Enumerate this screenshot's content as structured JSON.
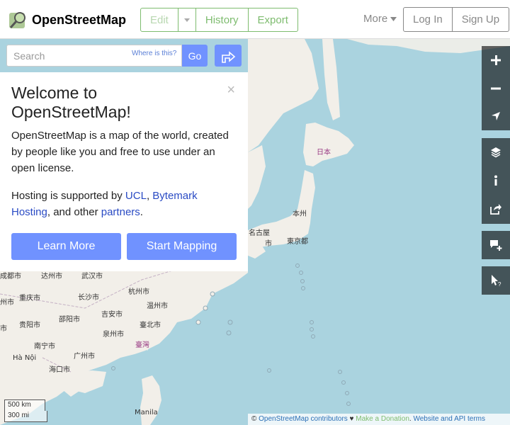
{
  "header": {
    "site_name": "OpenStreetMap",
    "edit_label": "Edit",
    "history_label": "History",
    "export_label": "Export",
    "more_label": "More",
    "login_label": "Log In",
    "signup_label": "Sign Up"
  },
  "search": {
    "placeholder": "Search",
    "where_label": "Where is this?",
    "go_label": "Go"
  },
  "welcome": {
    "title": "Welcome to OpenStreetMap!",
    "close": "×",
    "intro": "OpenStreetMap is a map of the world, created by people like you and free to use under an open license.",
    "hosting_prefix": "Hosting is supported by ",
    "ucl": "UCL",
    "sep": ", ",
    "bytemark": "Bytemark Hosting",
    "and_other": ", and other ",
    "partners": "partners",
    "dot": ".",
    "learn_more": "Learn More",
    "start_mapping": "Start Mapping"
  },
  "map": {
    "places": [
      {
        "label": "日本",
        "cls": "country"
      },
      {
        "label": "本州"
      },
      {
        "label": "名古屋"
      },
      {
        "label": "市"
      },
      {
        "label": "東京都"
      },
      {
        "label": "达州市"
      },
      {
        "label": "武汉市"
      },
      {
        "label": "重庆市"
      },
      {
        "label": "长沙市"
      },
      {
        "label": "杭州市"
      },
      {
        "label": "邵阳市"
      },
      {
        "label": "吉安市"
      },
      {
        "label": "温州市"
      },
      {
        "label": "贵阳市"
      },
      {
        "label": "泉州市"
      },
      {
        "label": "臺北市"
      },
      {
        "label": "南宁市"
      },
      {
        "label": "广州市"
      },
      {
        "label": "臺灣",
        "cls": "country"
      },
      {
        "label": "Hà Nội"
      },
      {
        "label": "海口市"
      },
      {
        "label": "Manila"
      },
      {
        "label": "成都市"
      },
      {
        "label": "市"
      },
      {
        "label": "州市"
      }
    ],
    "scale_km": "500 km",
    "scale_mi": "300 mi"
  },
  "attribution": {
    "copy": "© ",
    "contributors": "OpenStreetMap contributors",
    "heart": " ♥ ",
    "donate": "Make a Donation",
    "dot": ". ",
    "terms": "Website and API terms"
  },
  "controls": {
    "zoom_in": "+",
    "zoom_out": "−"
  },
  "colors": {
    "accent": "#7092ff",
    "brand_green": "#7ebc6f",
    "water": "#aad3df",
    "land": "#f2efe9"
  }
}
